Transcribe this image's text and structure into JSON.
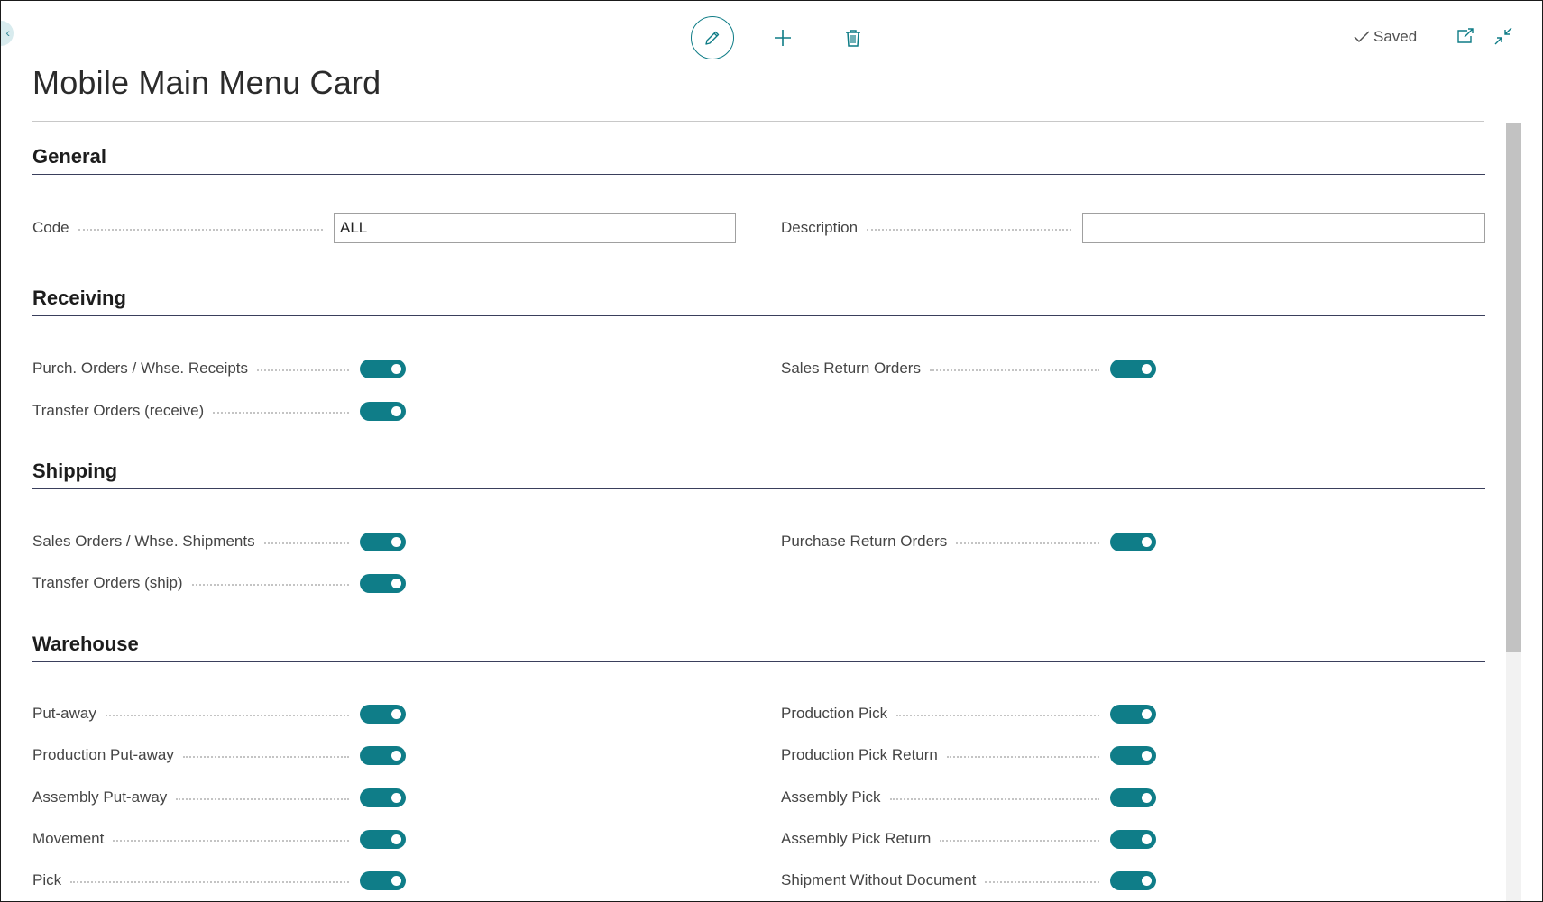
{
  "page": {
    "title": "Mobile Main Menu Card",
    "status": "Saved"
  },
  "toolbar": {
    "edit_icon": "pencil-icon",
    "add_icon": "plus-icon",
    "delete_icon": "trash-icon",
    "accent_color": "#0e7c86"
  },
  "general": {
    "heading": "General",
    "code_label": "Code",
    "code_value": "ALL",
    "description_label": "Description",
    "description_value": ""
  },
  "receiving": {
    "heading": "Receiving",
    "purch_orders_label": "Purch. Orders / Whse. Receipts",
    "purch_orders_on": true,
    "transfer_receive_label": "Transfer Orders (receive)",
    "transfer_receive_on": true,
    "sales_return_label": "Sales Return Orders",
    "sales_return_on": true
  },
  "shipping": {
    "heading": "Shipping",
    "sales_orders_label": "Sales Orders / Whse. Shipments",
    "sales_orders_on": true,
    "transfer_ship_label": "Transfer Orders (ship)",
    "transfer_ship_on": true,
    "purchase_return_label": "Purchase Return Orders",
    "purchase_return_on": true
  },
  "warehouse": {
    "heading": "Warehouse",
    "put_away_label": "Put-away",
    "production_put_away_label": "Production Put-away",
    "assembly_put_away_label": "Assembly Put-away",
    "movement_label": "Movement",
    "pick_label": "Pick",
    "production_pick_label": "Production Pick",
    "production_pick_return_label": "Production Pick Return",
    "assembly_pick_label": "Assembly Pick",
    "assembly_pick_return_label": "Assembly Pick Return",
    "shipment_without_doc_label": "Shipment Without Document",
    "all_on": true
  }
}
